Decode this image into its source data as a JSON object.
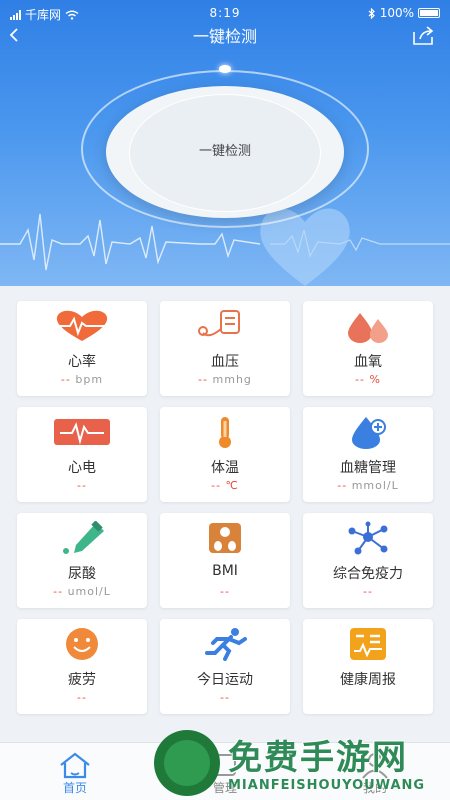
{
  "status_bar": {
    "carrier": "千库网",
    "time": "8:19",
    "battery": "100%"
  },
  "header": {
    "title": "一键检测"
  },
  "hero": {
    "button_label": "一键检测"
  },
  "cards": [
    {
      "name": "心率",
      "dash": "--",
      "unit": "bpm",
      "icon": "heart-rate-icon",
      "color": "#f06a3a"
    },
    {
      "name": "血压",
      "dash": "--",
      "unit": "mmhg",
      "icon": "blood-pressure-icon",
      "color": "#e8734a"
    },
    {
      "name": "血氧",
      "dash": "--",
      "unit": "%",
      "icon": "blood-oxygen-icon",
      "color": "#e8735a"
    },
    {
      "name": "心电",
      "dash": "--",
      "unit": "",
      "icon": "ecg-icon",
      "color": "#e8614a"
    },
    {
      "name": "体温",
      "dash": "--",
      "unit": "℃",
      "icon": "thermometer-icon",
      "color": "#ef8a2a"
    },
    {
      "name": "血糖管理",
      "dash": "--",
      "unit": "mmol/L",
      "icon": "blood-sugar-icon",
      "color": "#3b7fe0"
    },
    {
      "name": "尿酸",
      "dash": "--",
      "unit": "umol/L",
      "icon": "dropper-icon",
      "color": "#3fb58a"
    },
    {
      "name": "BMI",
      "dash": "--",
      "unit": "",
      "icon": "scale-icon",
      "color": "#d9823a"
    },
    {
      "name": "综合免疫力",
      "dash": "--",
      "unit": "",
      "icon": "molecule-icon",
      "color": "#3b6fd6"
    },
    {
      "name": "疲劳",
      "dash": "--",
      "unit": "",
      "icon": "smile-icon",
      "color": "#f08a3a"
    },
    {
      "name": "今日运动",
      "dash": "--",
      "unit": "",
      "icon": "running-icon",
      "color": "#3b7fe0"
    },
    {
      "name": "健康周报",
      "dash": "",
      "unit": "",
      "icon": "report-icon",
      "color": "#f3a21c"
    }
  ],
  "tabs": [
    {
      "label": "首页",
      "icon": "home-icon",
      "active": true
    },
    {
      "label": "管理",
      "icon": "manage-icon",
      "active": false
    },
    {
      "label": "我的",
      "icon": "profile-icon",
      "active": false
    }
  ],
  "watermark": {
    "title": "免费手游网",
    "subtitle": "MIANFEISHOUYOUWANG"
  },
  "colors": {
    "primary": "#3b8ae8",
    "accent_red": "#e94b3c",
    "active_tab": "#3b8ae8"
  }
}
